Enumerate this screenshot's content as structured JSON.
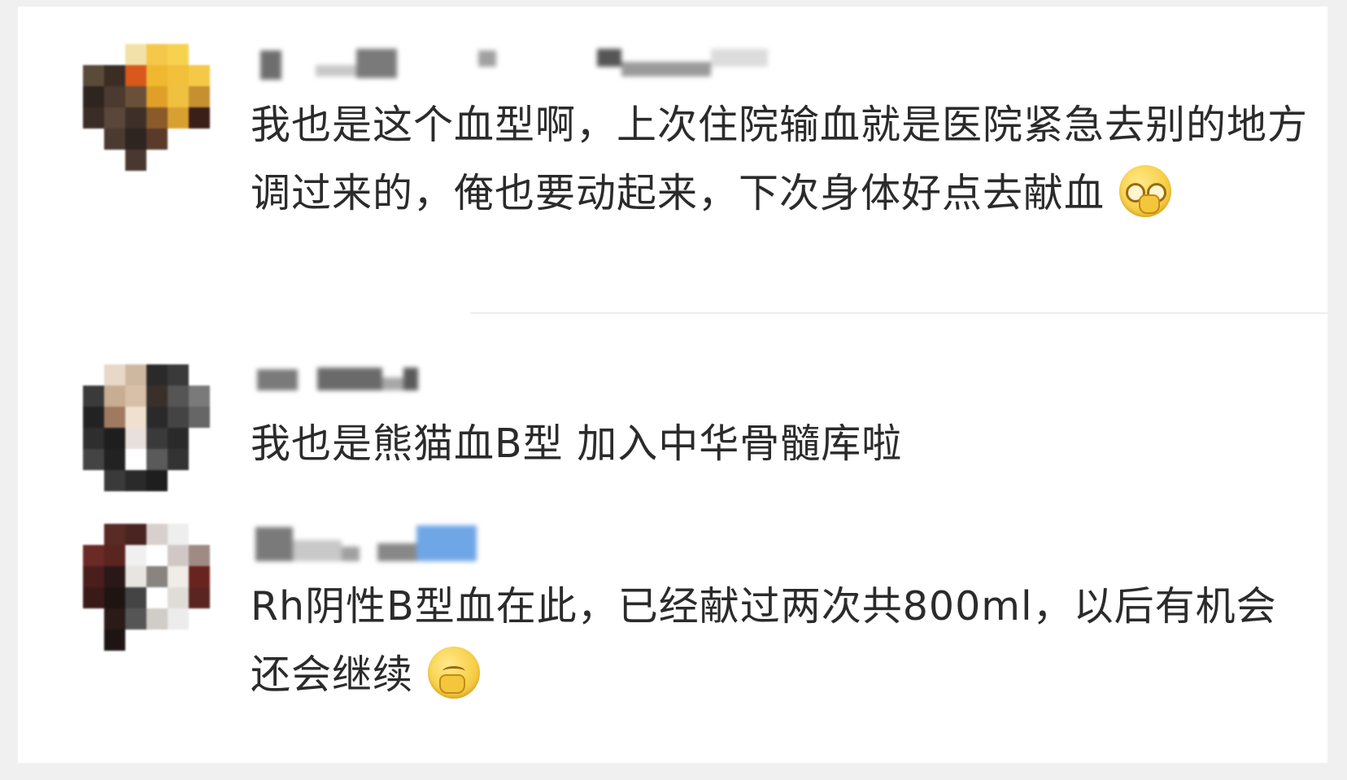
{
  "comments": [
    {
      "text": "我也是这个血型啊，上次住院输血就是医院紧急去别的地方调过来的，俺也要动起来，下次身体好点去献血",
      "emoji": "glasses-face-emoji"
    },
    {
      "text": "我也是熊猫血B型 加入中华骨髓库啦"
    },
    {
      "text": "Rh阴性B型血在此，已经献过两次共800ml，以后有机会还会继续",
      "emoji": "covering-mouth-smile-emoji"
    }
  ],
  "colors": {
    "background": "#f0f0f0",
    "card": "#ffffff",
    "text": "#2b2b2b",
    "divider": "#ececec",
    "emoji": "#f7d04a"
  }
}
